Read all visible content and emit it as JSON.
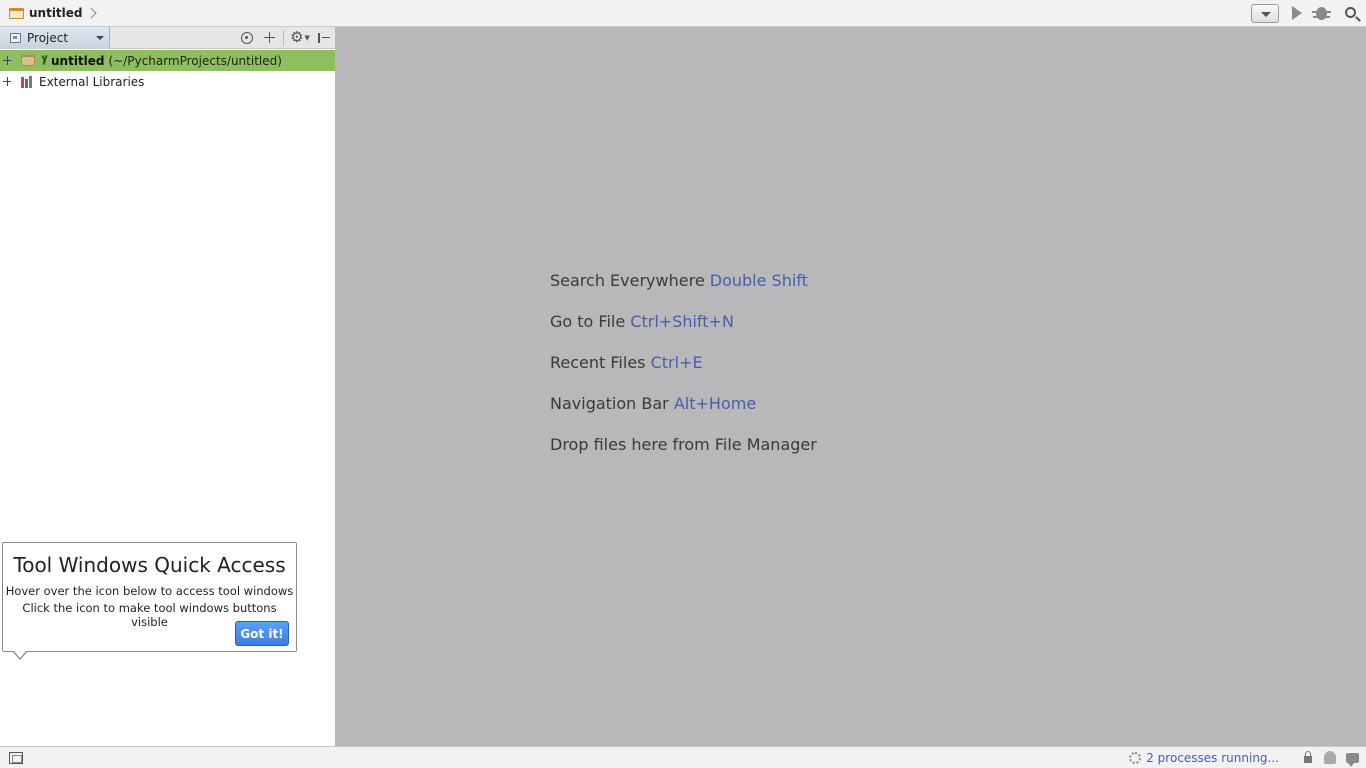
{
  "navbar": {
    "breadcrumb": "untitled"
  },
  "project_panel": {
    "view_label": "Project",
    "tree": [
      {
        "name": "untitled",
        "path": "(~/PycharmProjects/untitled)"
      },
      {
        "name": "External Libraries"
      }
    ]
  },
  "balloon": {
    "title": "Tool Windows Quick Access",
    "line1": "Hover over the icon below to access tool windows",
    "line2": "Click the icon to make tool windows buttons visible",
    "button": "Got it!"
  },
  "editor": {
    "hints": [
      {
        "action": "Search Everywhere",
        "shortcut": "Double Shift"
      },
      {
        "action": "Go to File",
        "shortcut": "Ctrl+Shift+N"
      },
      {
        "action": "Recent Files",
        "shortcut": "Ctrl+E"
      },
      {
        "action": "Navigation Bar",
        "shortcut": "Alt+Home"
      },
      {
        "action": "Drop files here from File Manager",
        "shortcut": ""
      }
    ]
  },
  "statusbar": {
    "processes": "2 processes running..."
  },
  "colors": {
    "editor_background": "#b8b8ba",
    "shortcut_text": "#4a5ea6",
    "selected_row": "#8fbf5c",
    "got_it_button": "#3d7ee3"
  },
  "icons": [
    "folder-icon",
    "run-config-dropdown-icon",
    "run-icon",
    "debug-icon",
    "search-icon",
    "project-view-icon",
    "locate-icon",
    "collapse-all-icon",
    "gear-icon",
    "hide-panel-icon",
    "library-icon",
    "tool-windows-icon",
    "lock-icon",
    "inspector-icon",
    "event-log-icon"
  ]
}
